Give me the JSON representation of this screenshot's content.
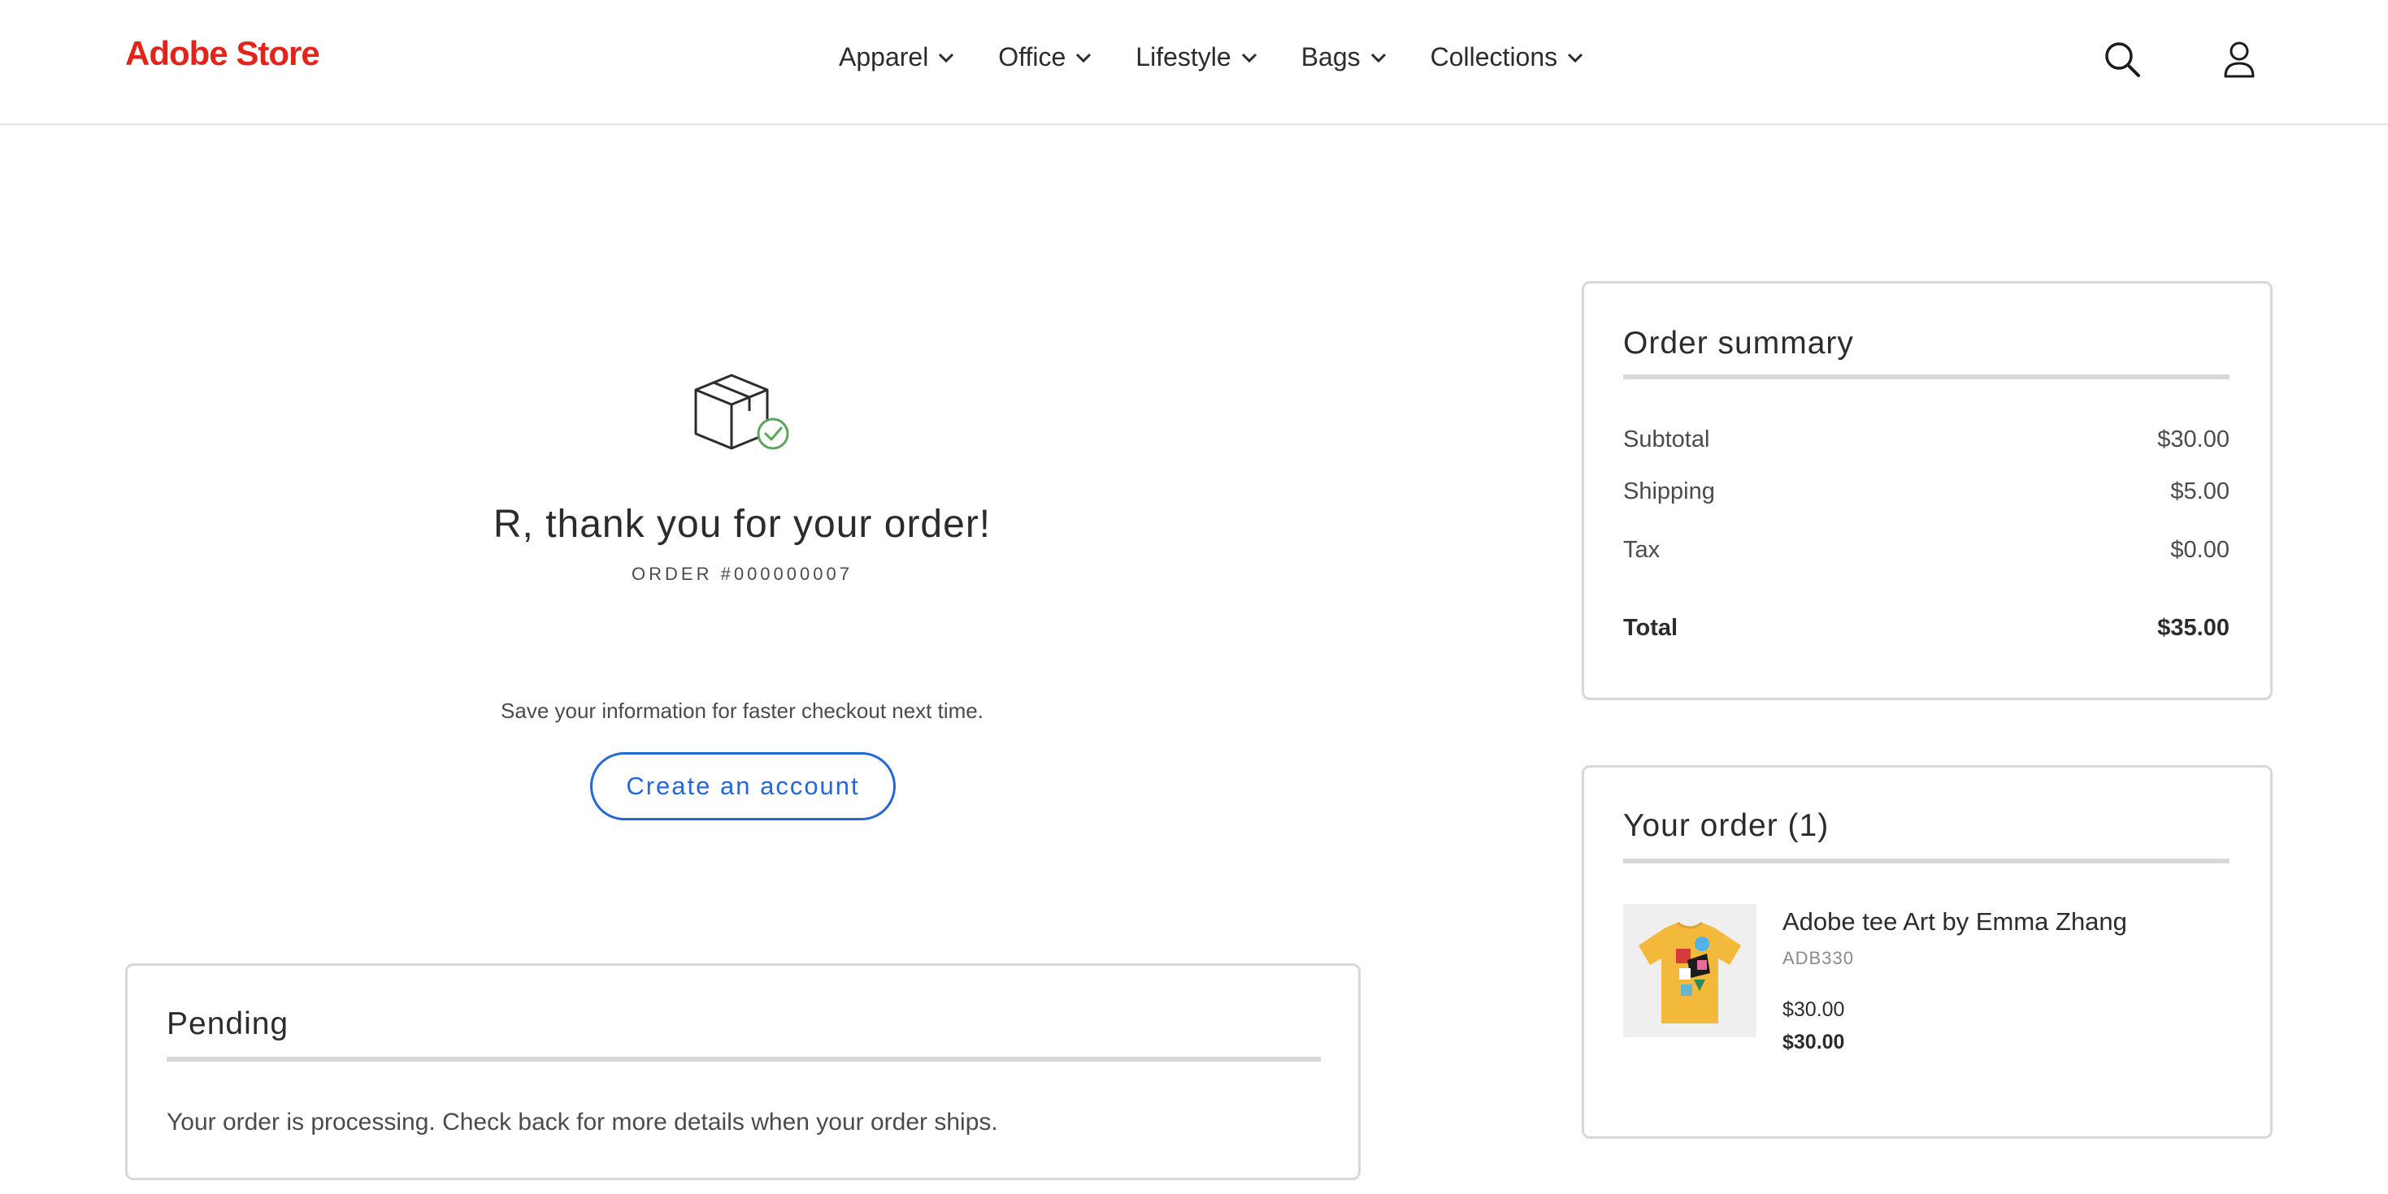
{
  "header": {
    "logo": "Adobe Store",
    "nav": [
      {
        "label": "Apparel"
      },
      {
        "label": "Office"
      },
      {
        "label": "Lifestyle"
      },
      {
        "label": "Bags"
      },
      {
        "label": "Collections"
      }
    ],
    "icons": [
      "search-icon",
      "account-icon"
    ]
  },
  "confirmation": {
    "icon": "box-check-icon",
    "thanks": "R, thank you for your order!",
    "order_number": "ORDER #000000007",
    "save_info": "Save your information for faster checkout next time.",
    "create_account_label": "Create an account"
  },
  "pending": {
    "title": "Pending",
    "message": "Your order is processing. Check back for more details when your order ships."
  },
  "summary": {
    "title": "Order summary",
    "rows": [
      {
        "label": "Subtotal",
        "value": "$30.00"
      },
      {
        "label": "Shipping",
        "value": "$5.00"
      },
      {
        "label": "Tax",
        "value": "$0.00"
      }
    ],
    "total": {
      "label": "Total",
      "value": "$35.00"
    }
  },
  "your_order": {
    "title": "Your order (1)",
    "items": [
      {
        "name": "Adobe tee Art by Emma Zhang",
        "sku": "ADB330",
        "price": "$30.00",
        "line_total": "$30.00"
      }
    ]
  },
  "colors": {
    "brand": "#e1251b",
    "accent": "#2467d6",
    "success": "#5aa65a",
    "border": "#d8d8d8"
  }
}
